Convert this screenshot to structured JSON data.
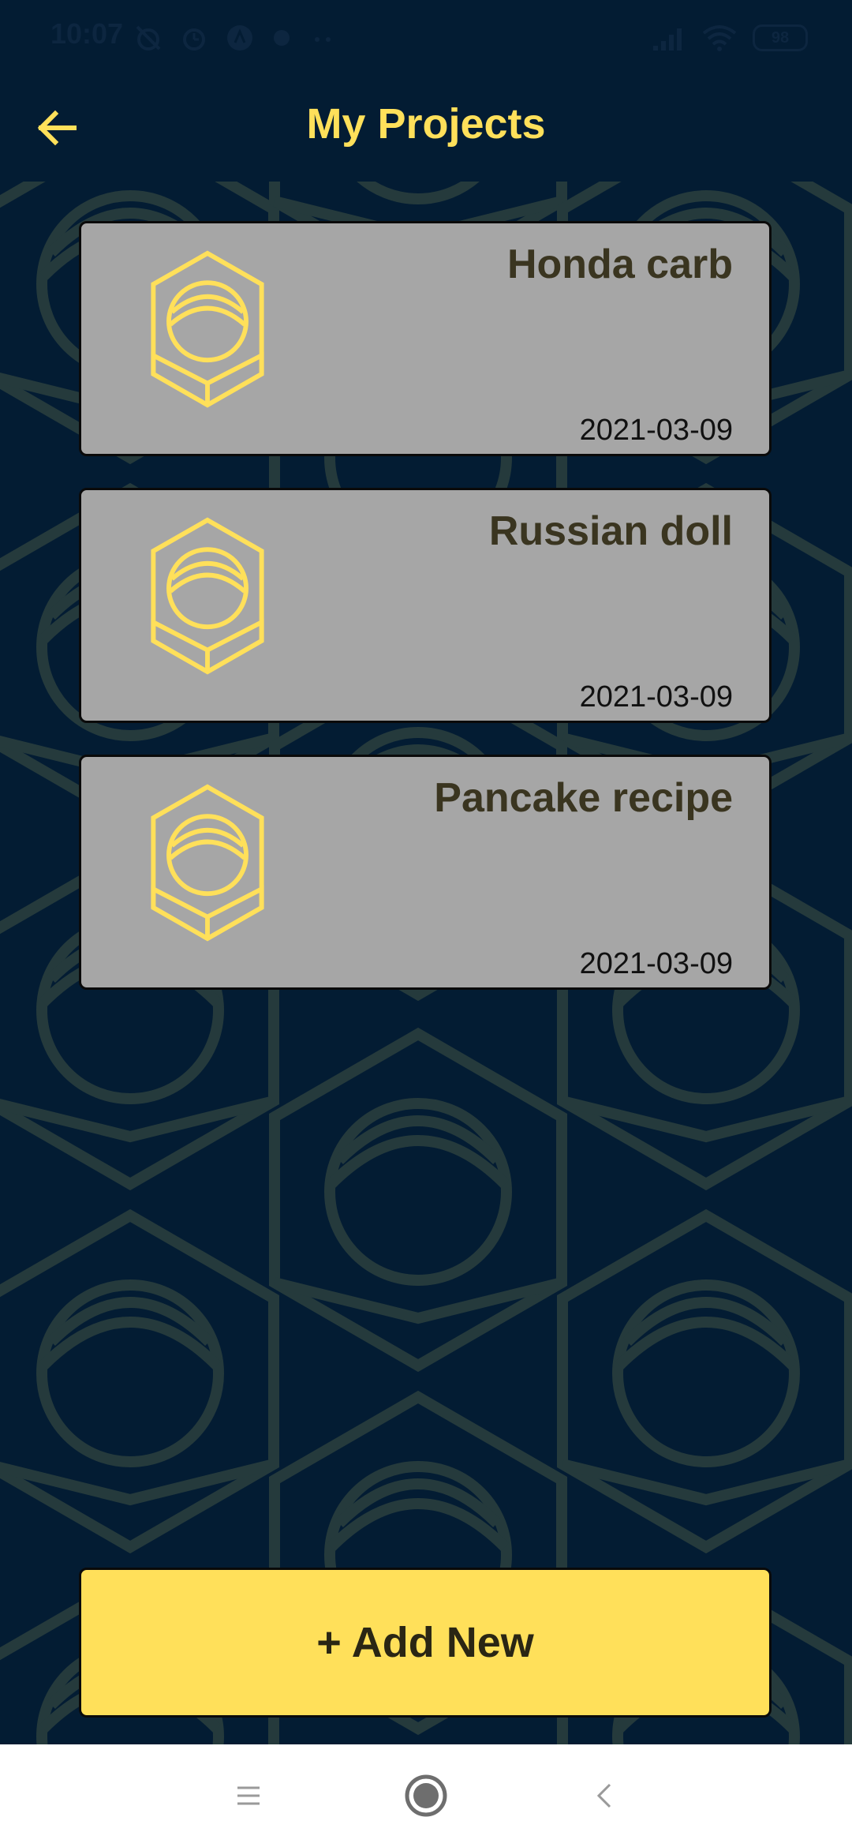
{
  "status_bar": {
    "time": "10:07",
    "battery": "98",
    "icons_left": [
      "alarm-off-icon",
      "alarm-icon",
      "app-notification-icon",
      "dot-icon",
      "more-dots-icon"
    ],
    "icons_right": [
      "signal-icon",
      "wifi-icon",
      "battery-icon"
    ]
  },
  "app_bar": {
    "title": "My Projects",
    "back_icon": "arrow-left-icon"
  },
  "projects": [
    {
      "title": "Honda carb",
      "date": "2021-03-09",
      "icon": "hex-nut-icon"
    },
    {
      "title": "Russian doll",
      "date": "2021-03-09",
      "icon": "hex-nut-icon"
    },
    {
      "title": "Pancake recipe",
      "date": "2021-03-09",
      "icon": "hex-nut-icon"
    }
  ],
  "add_button": {
    "label": "+ Add New"
  },
  "nav_bar": {
    "items": [
      "menu-icon",
      "home-icon",
      "back-icon"
    ]
  },
  "colors": {
    "background": "#031c33",
    "accent": "#ffe05a",
    "card": "#a6a6a6",
    "card_title": "#3a3520",
    "pattern": "#2a3a3a"
  }
}
